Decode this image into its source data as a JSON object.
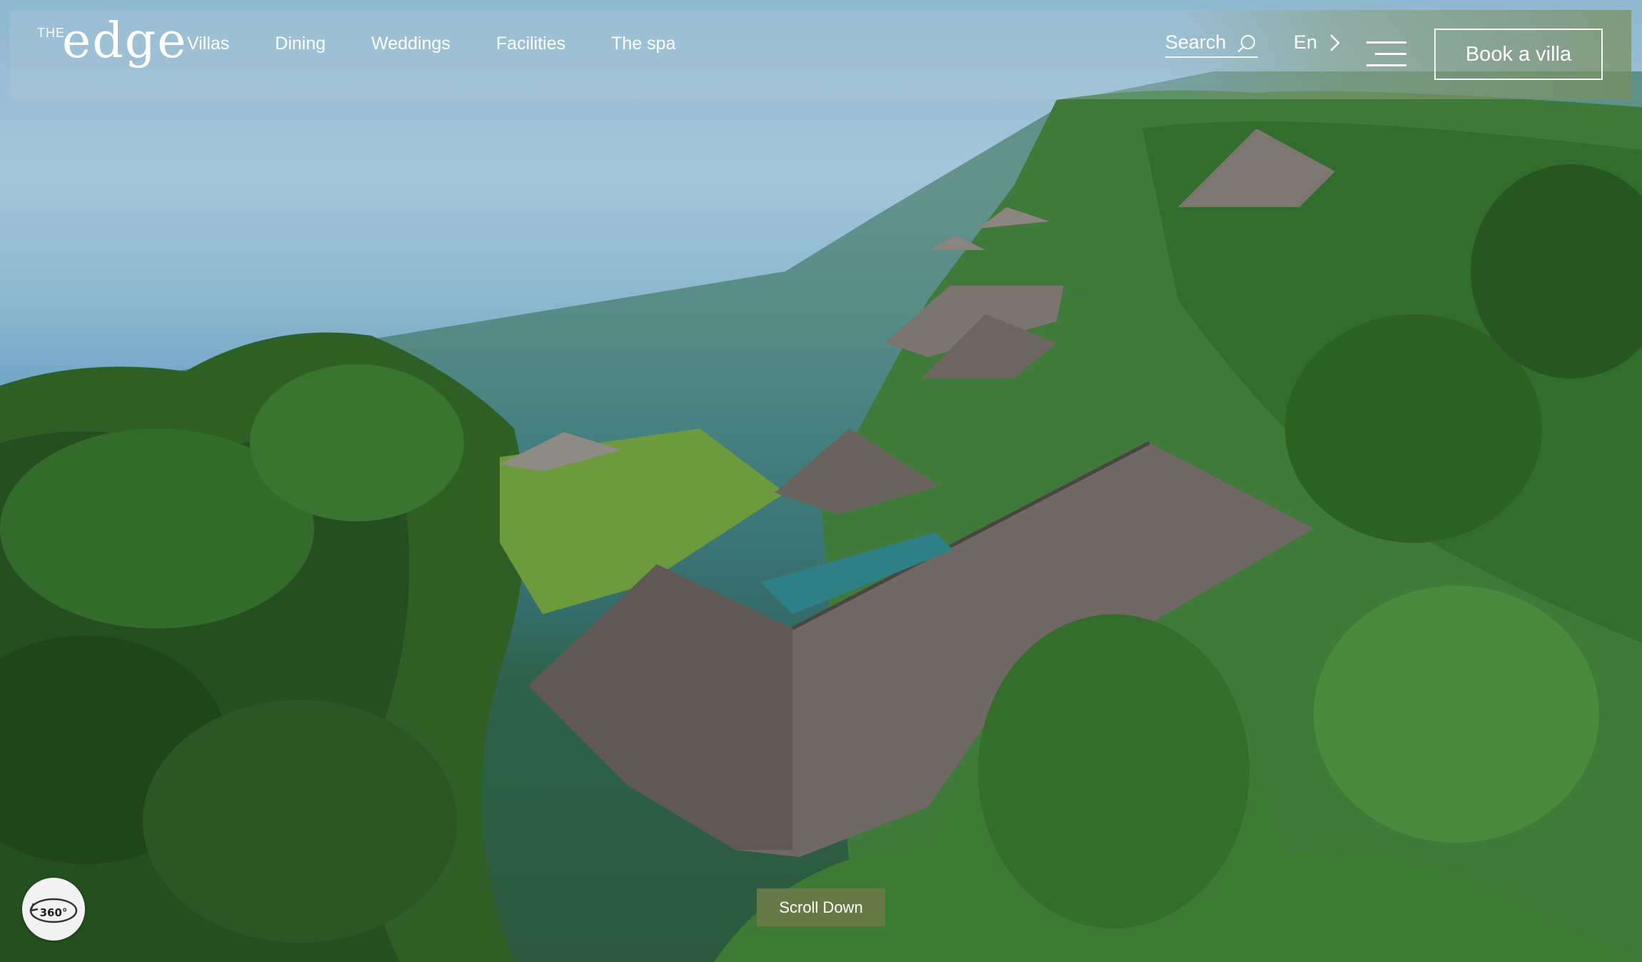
{
  "brand": {
    "prefix": "THE",
    "name": "edge"
  },
  "nav": {
    "items": [
      {
        "label": "Villas"
      },
      {
        "label": "Dining"
      },
      {
        "label": "Weddings"
      },
      {
        "label": "Facilities"
      },
      {
        "label": "The spa"
      }
    ]
  },
  "header": {
    "search_label": "Search",
    "language_label": "En",
    "book_label": "Book a villa"
  },
  "controls": {
    "pano_label": "360°",
    "scroll_label": "Scroll Down"
  },
  "colors": {
    "accent_olive": "#687a4a",
    "button_bg": "#f2f2f2"
  }
}
